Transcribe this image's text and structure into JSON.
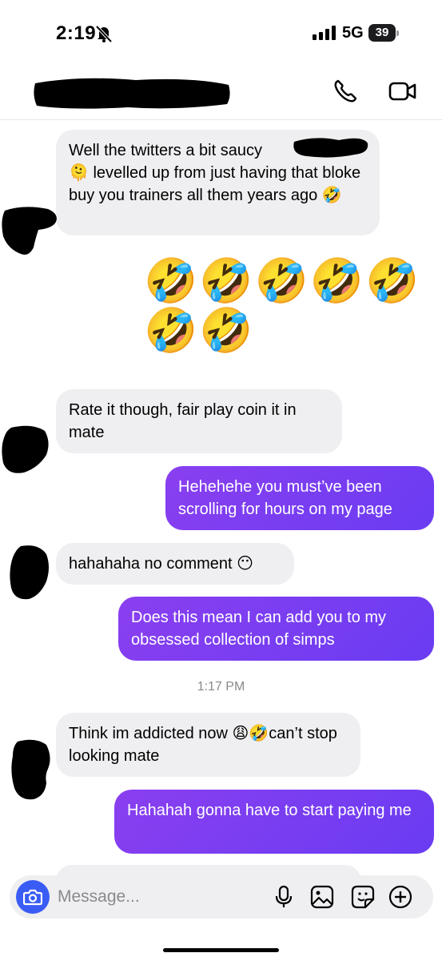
{
  "status_bar": {
    "time": "2:19",
    "network": "5G",
    "battery": "39"
  },
  "header": {
    "contact_name": "",
    "icons": [
      "phone-icon",
      "video-icon"
    ]
  },
  "messages": [
    {
      "side": "in",
      "text": "Well the twitters a bit saucy       🫠 levelled up from just having that bloke buy you trainers all them years ago 🤣"
    },
    {
      "side": "out",
      "type": "emoji",
      "text": "🤣🤣🤣🤣🤣🤣🤣"
    },
    {
      "side": "in",
      "text": "Rate it though, fair play coin it in mate"
    },
    {
      "side": "out",
      "text": "Hehehehe you must’ve been scrolling for hours on my page"
    },
    {
      "side": "in",
      "text": "hahahaha no comment 😶"
    },
    {
      "side": "out",
      "text": "Does this mean I can add you to my obsessed collection of simps"
    },
    {
      "side": "in",
      "text": "Think im addicted now 😩🤣can’t stop looking mate"
    },
    {
      "side": "out",
      "text": "Hahahah gonna have to start paying me"
    }
  ],
  "timestamp": "1:17 PM",
  "composer": {
    "placeholder": "Message...",
    "icons": [
      "camera-icon",
      "microphone-icon",
      "gallery-icon",
      "sticker-icon",
      "plus-icon"
    ]
  },
  "colors": {
    "accent": "#7a3ef0",
    "incoming_bubble": "#efeff1",
    "camera_button": "#3a5cf5"
  }
}
